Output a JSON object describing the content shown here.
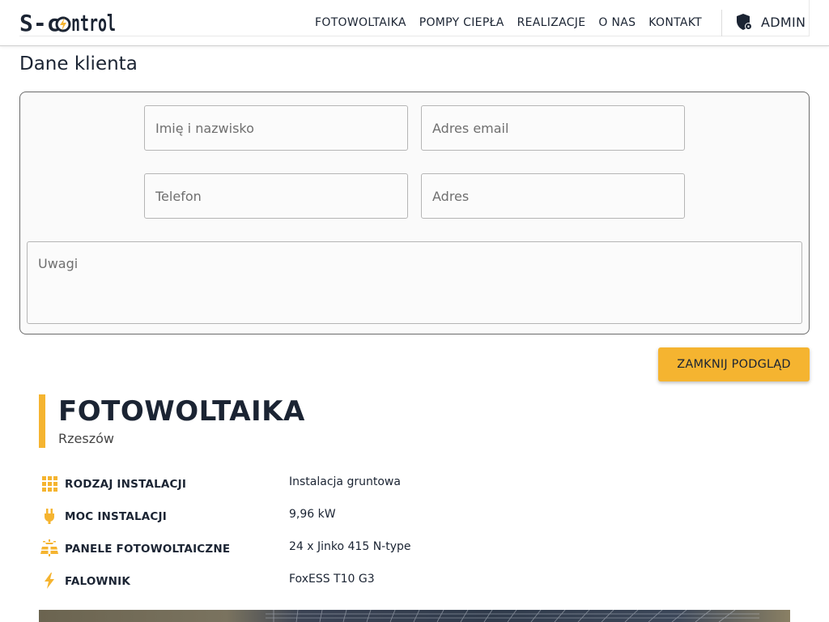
{
  "brand": {
    "logo_text_a": "S-c",
    "logo_text_b": "ntrol",
    "accent": "#f5b430",
    "dark": "#1b2433"
  },
  "nav": {
    "items": [
      "FOTOWOLTAIKA",
      "POMPY CIEPŁA",
      "REALIZACJE",
      "O NAS",
      "KONTAKT"
    ],
    "admin_label": "ADMIN"
  },
  "client_section": {
    "title": "Dane klienta",
    "fields": {
      "name_placeholder": "Imię i nazwisko",
      "email_placeholder": "Adres email",
      "phone_placeholder": "Telefon",
      "address_placeholder": "Adres",
      "notes_placeholder": "Uwagi"
    },
    "close_button": "ZAMKNIJ PODGLĄD"
  },
  "product": {
    "title": "FOTOWOLTAIKA",
    "location": "Rzeszów",
    "specs": [
      {
        "icon": "grid-icon",
        "label": "RODZAJ INSTALACJI",
        "value": "Instalacja gruntowa"
      },
      {
        "icon": "plug-icon",
        "label": "MOC INSTALACJI",
        "value": "9,96 kW"
      },
      {
        "icon": "solar-panel-icon",
        "label": "PANELE FOTOWOLTAICZNE",
        "value": "24 x Jinko 415 N-type"
      },
      {
        "icon": "bolt-icon",
        "label": "FALOWNIK",
        "value": "FoxESS T10 G3"
      }
    ]
  }
}
